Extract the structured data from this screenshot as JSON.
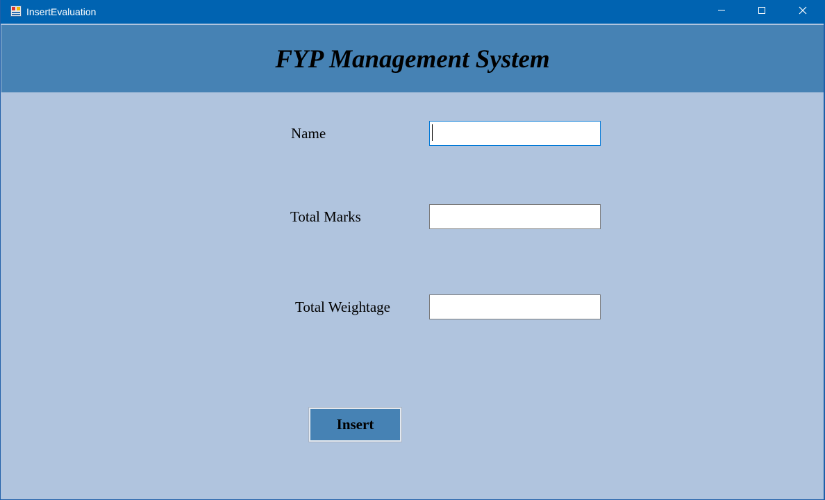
{
  "window": {
    "title": "InsertEvaluation",
    "icon": "winforms-app-icon",
    "controls": [
      "minimize-icon",
      "maximize-icon",
      "close-icon"
    ]
  },
  "header": {
    "title": "FYP Management System"
  },
  "form": {
    "name_label": "Name",
    "name_value": "",
    "total_marks_label": "Total Marks",
    "total_marks_value": "",
    "total_weightage_label": "Total Weightage",
    "total_weightage_value": "",
    "insert_label": "Insert"
  },
  "colors": {
    "titlebar": "#0063b1",
    "header_band": "#4682b4",
    "form_background": "#b0c4de",
    "button": "#4682b4",
    "focus_border": "#0078d7"
  }
}
